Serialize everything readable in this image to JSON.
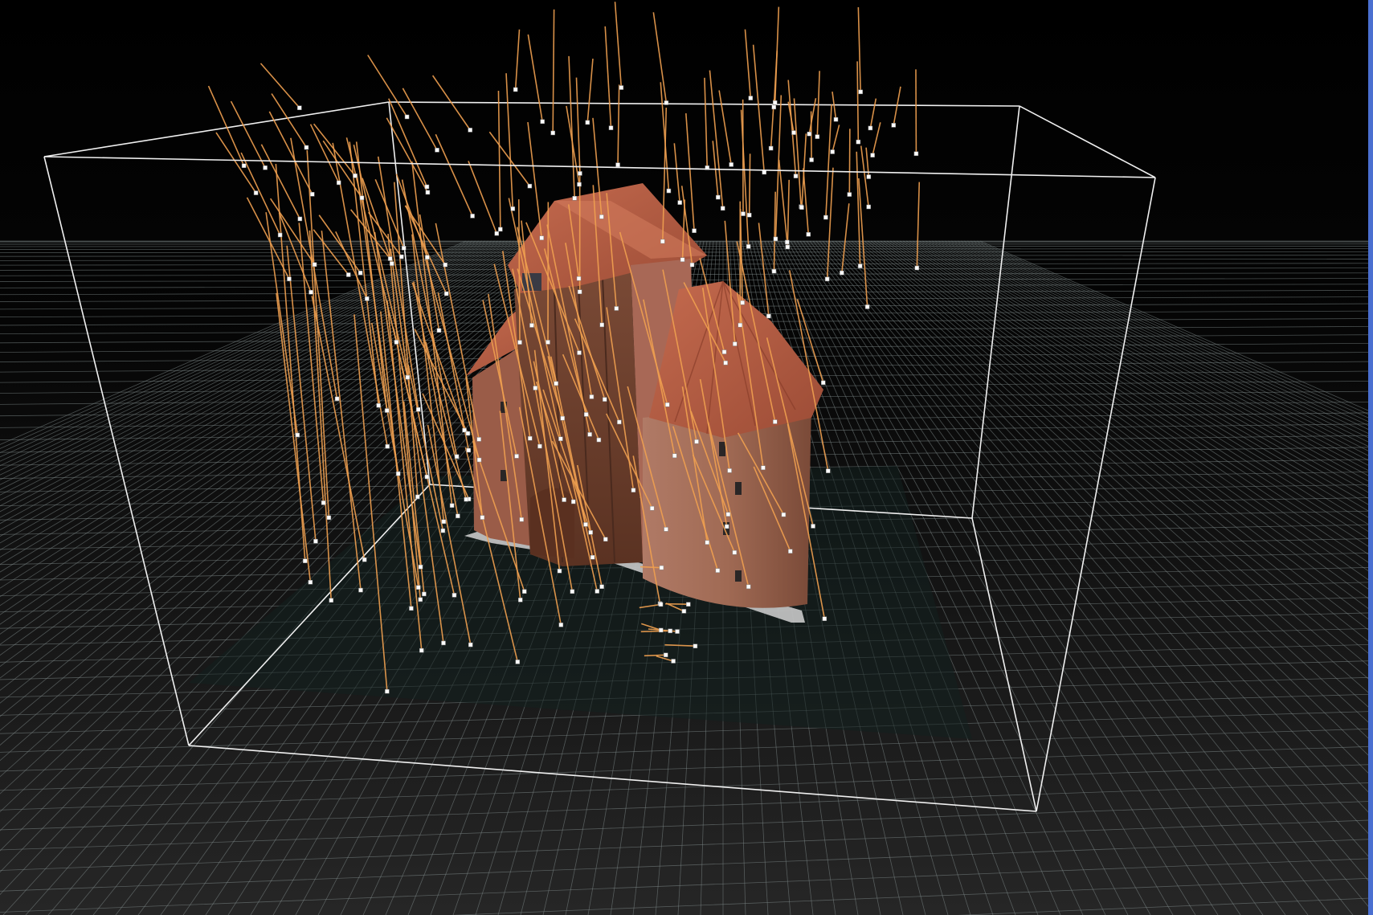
{
  "viewport": {
    "name": "3d-reconstruction-viewport",
    "background_top": "#000000",
    "background_bottom": "#2a2a2a",
    "grid_color": "#7f8a8a",
    "grid_fill_inside_box": "#12201f",
    "bounding_box_color": "#f0f0f0",
    "camera_ray_color": "#f0a050",
    "camera_center_color": "#ffffff",
    "roof_color": "#b25a40",
    "brick_color": "#9a5a44",
    "timber_color": "#6a3a28",
    "base_color": "#cfcfcf",
    "scroll_strip_color": "#4a6fd0"
  }
}
